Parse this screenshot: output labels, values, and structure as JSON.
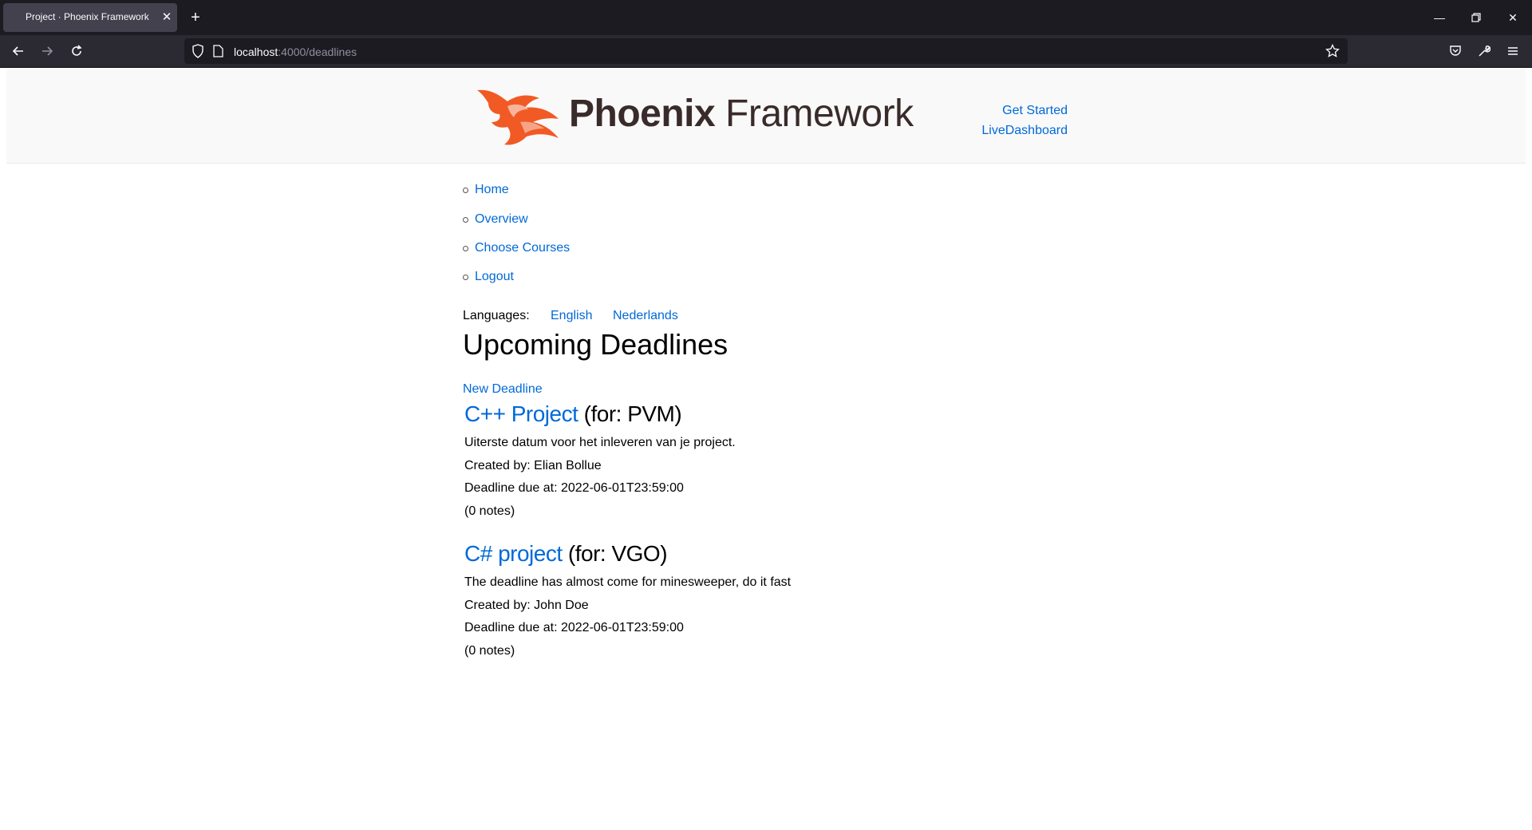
{
  "browser": {
    "tab_title": "Project · Phoenix Framework",
    "url_host": "localhost",
    "url_path": ":4000/deadlines"
  },
  "header": {
    "logo_bold": "Phoenix",
    "logo_light": " Framework",
    "links": [
      "Get Started",
      "LiveDashboard"
    ]
  },
  "nav": {
    "items": [
      "Home",
      "Overview",
      "Choose Courses",
      "Logout"
    ]
  },
  "languages": {
    "label": "Languages:",
    "options": [
      "English",
      "Nederlands"
    ]
  },
  "page": {
    "title": "Upcoming Deadlines",
    "new_deadline": "New Deadline"
  },
  "deadlines": [
    {
      "name": "C++ Project",
      "for": " (for: PVM)",
      "description": "Uiterste datum voor het inleveren van je project.",
      "created_by": "Created by: Elian Bollue",
      "due": "Deadline due at: 2022-06-01T23:59:00",
      "notes": "(0 notes)"
    },
    {
      "name": "C# project",
      "for": " (for: VGO)",
      "description": "The deadline has almost come for minesweeper, do it fast",
      "created_by": "Created by: John Doe",
      "due": "Deadline due at: 2022-06-01T23:59:00",
      "notes": "(0 notes)"
    }
  ],
  "colors": {
    "link": "#0069d9",
    "logo_orange": "#f15a24",
    "chrome_dark": "#1c1b22"
  },
  "icons": {
    "back": "arrow-left-icon",
    "forward": "arrow-right-icon",
    "reload": "reload-icon",
    "shield": "shield-icon",
    "page": "page-icon",
    "bookmark": "star-icon",
    "pocket": "pocket-icon",
    "tools": "wrench-icon",
    "menu": "hamburger-menu-icon"
  }
}
